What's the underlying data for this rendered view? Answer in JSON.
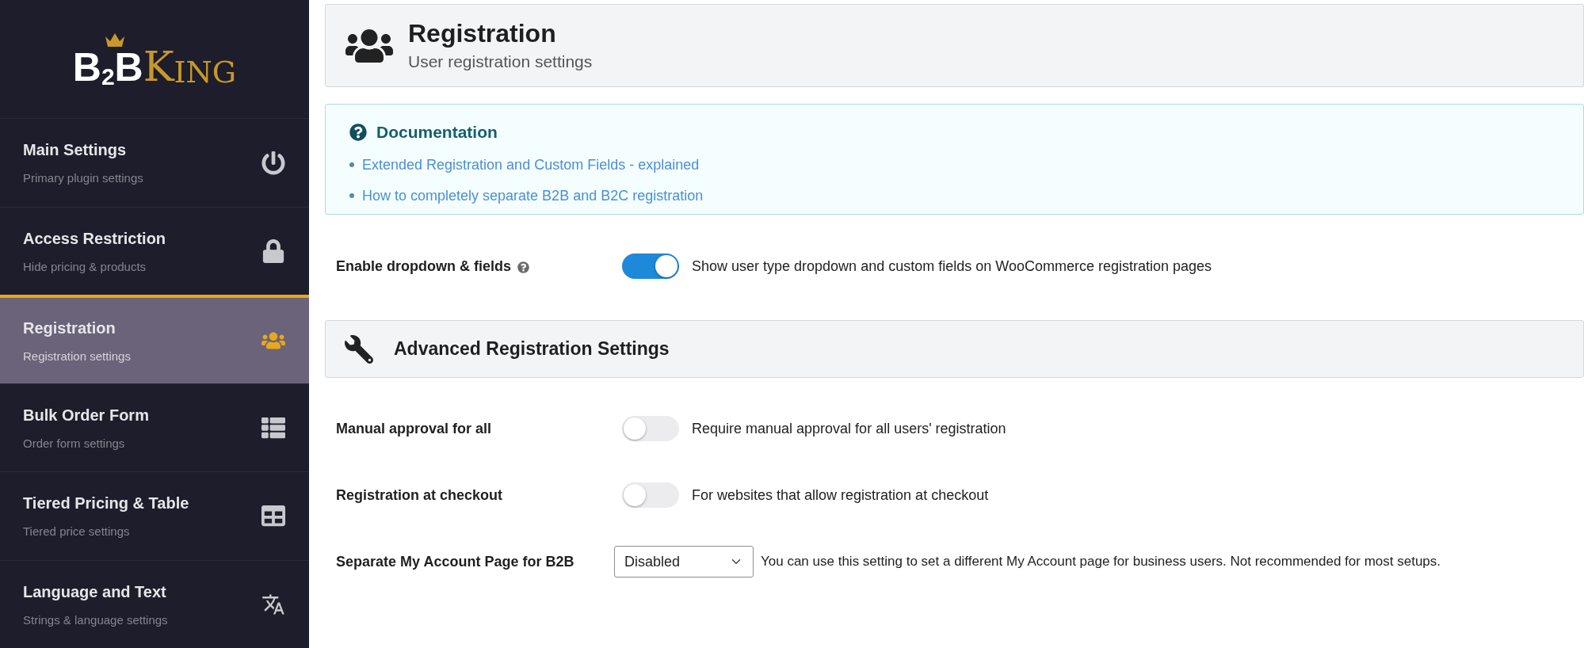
{
  "logo": [
    {
      "text": "B",
      "kind": "main"
    },
    {
      "text": "2",
      "kind": "sub"
    },
    {
      "text": "B",
      "kind": "main"
    },
    {
      "text": "K",
      "kind": "gold-cap"
    },
    {
      "text": "ING",
      "kind": "gold"
    }
  ],
  "sidebar": {
    "items": [
      {
        "title": "Main Settings",
        "subtitle": "Primary plugin settings",
        "selected": false
      },
      {
        "title": "Access Restriction",
        "subtitle": "Hide pricing & products",
        "selected": false
      },
      {
        "title": "Registration",
        "subtitle": "Registration settings",
        "selected": true
      },
      {
        "title": "Bulk Order Form",
        "subtitle": "Order form settings",
        "selected": false
      },
      {
        "title": "Tiered Pricing & Table",
        "subtitle": "Tiered price settings",
        "selected": false
      },
      {
        "title": "Language and Text",
        "subtitle": "Strings & language settings",
        "selected": false
      }
    ]
  },
  "header": {
    "title": "Registration",
    "subtitle": "User registration settings"
  },
  "documentation": {
    "title": "Documentation",
    "links": [
      "Extended Registration and Custom Fields - explained",
      "How to completely separate B2B and B2C registration"
    ]
  },
  "main_settings": [
    {
      "label": "Enable dropdown & fields",
      "help": true,
      "kind": "toggle",
      "on": true,
      "description": "Show user type dropdown and custom fields on WooCommerce registration pages"
    }
  ],
  "advanced": {
    "title": "Advanced Registration Settings",
    "settings": [
      {
        "label": "Manual approval for all",
        "help": false,
        "kind": "toggle",
        "on": false,
        "description": "Require manual approval for all users' registration"
      },
      {
        "label": "Registration at checkout",
        "help": false,
        "kind": "toggle",
        "on": false,
        "description": "For websites that allow registration at checkout"
      },
      {
        "label": "Separate My Account Page for B2B",
        "help": false,
        "kind": "select",
        "value": "Disabled",
        "description": "You can use this setting to set a different My Account page for business users. Not recommended for most setups."
      }
    ]
  }
}
